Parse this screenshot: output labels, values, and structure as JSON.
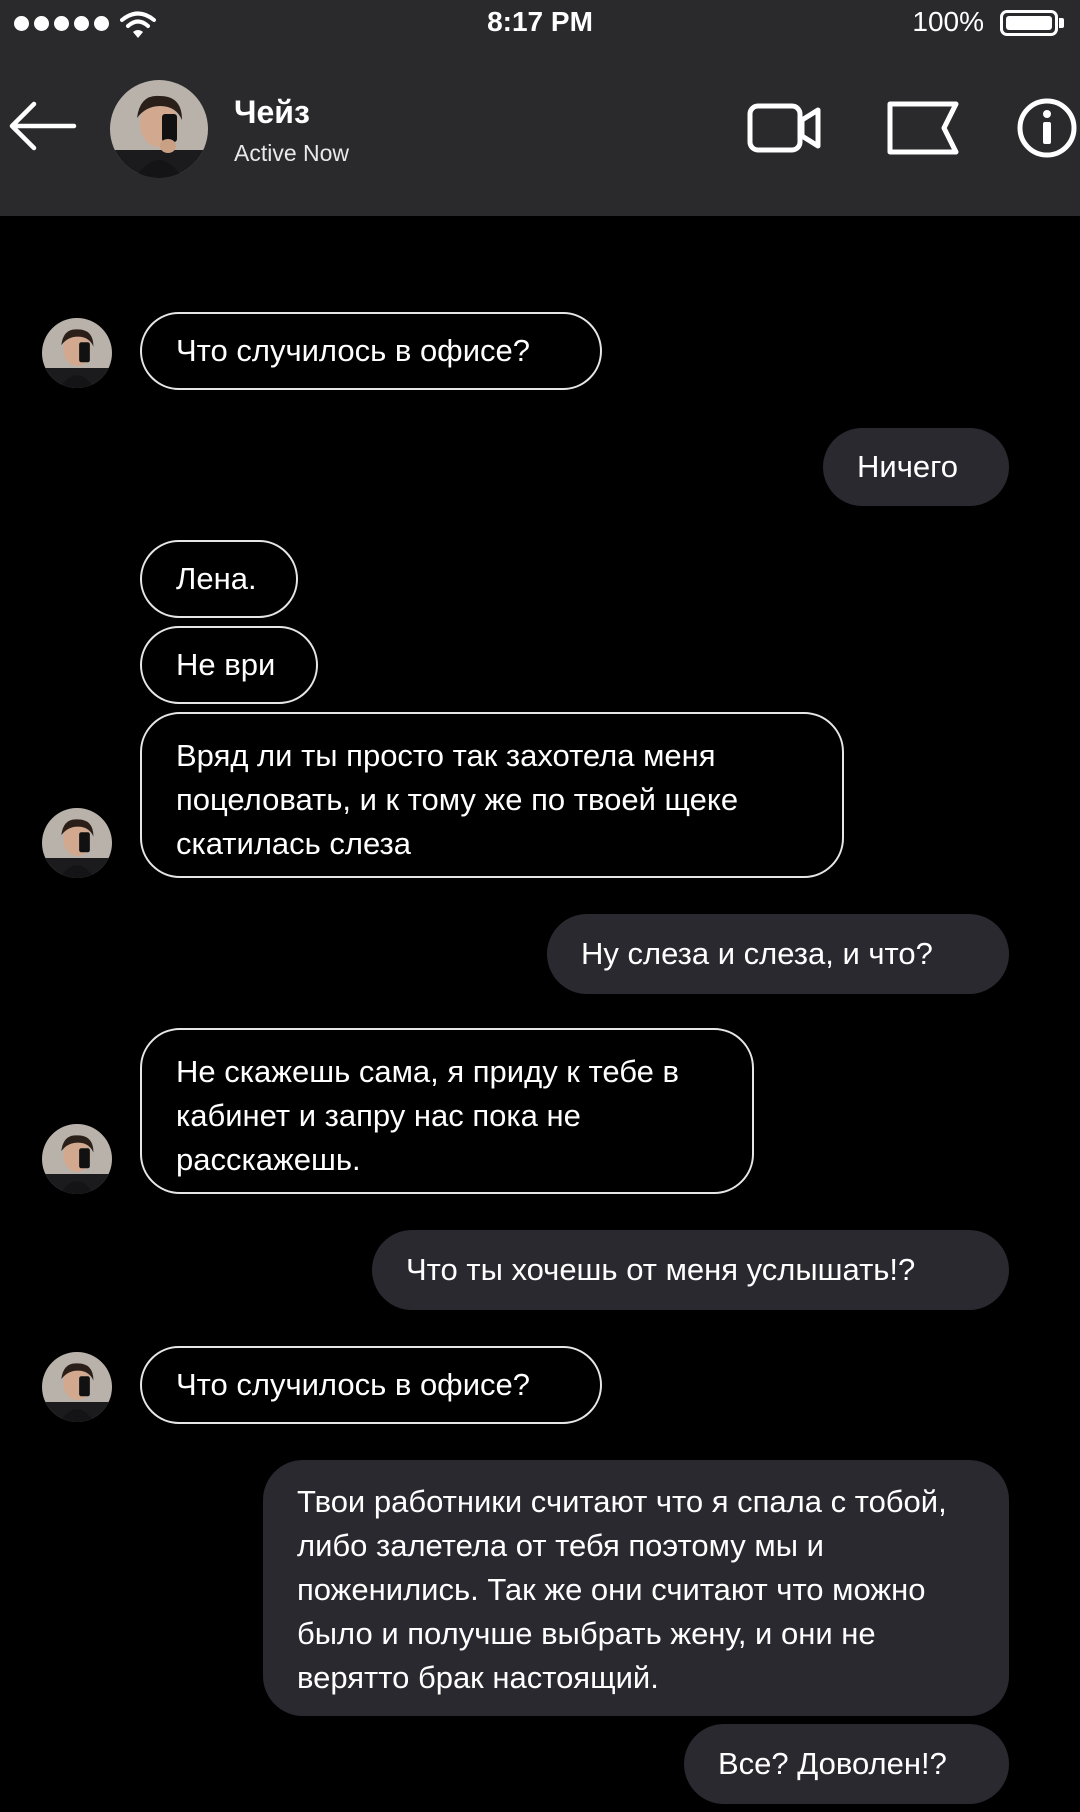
{
  "status_bar": {
    "time": "8:17 PM",
    "battery": "100%"
  },
  "header": {
    "contact_name": "Чейз",
    "contact_status": "Active Now"
  },
  "icons": {
    "back": "arrow-left-icon",
    "video": "video-camera-icon",
    "flag": "flag-icon",
    "info": "info-icon"
  },
  "messages": [
    {
      "side": "incoming",
      "text": "Что случилось в офисе?"
    },
    {
      "side": "outgoing",
      "text": "Ничего"
    },
    {
      "side": "incoming",
      "text": "Лена."
    },
    {
      "side": "incoming",
      "text": "Не ври"
    },
    {
      "side": "incoming",
      "text": "Вряд ли ты просто так захотела меня поцеловать, и к тому же по твоей щеке скатилась слеза"
    },
    {
      "side": "outgoing",
      "text": "Ну слеза и слеза, и что?"
    },
    {
      "side": "incoming",
      "text": "Не скажешь сама, я приду к тебе в кабинет и запру нас пока не расскажешь."
    },
    {
      "side": "outgoing",
      "text": "Что ты хочешь от меня услышать!?"
    },
    {
      "side": "incoming",
      "text": "Что случилось в офисе?"
    },
    {
      "side": "outgoing",
      "text": "Твои работники считают что я спала с тобой, либо залетела от тебя поэтому мы и поженились. Так же они считают что можно было и получше выбрать жену, и они не верятто брак настоящий."
    },
    {
      "side": "outgoing",
      "text": "Все? Доволен!?"
    }
  ],
  "colors": {
    "header_bg": "#2a2a2c",
    "background": "#000000",
    "outgoing_bubble": "#2b2930",
    "incoming_border": "#e6e6e6"
  }
}
